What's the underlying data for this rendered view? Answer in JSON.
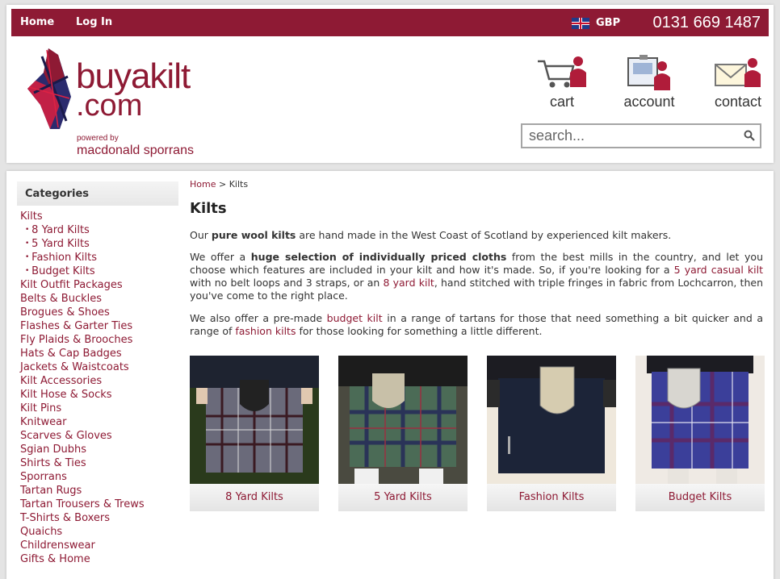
{
  "topbar": {
    "home": "Home",
    "login": "Log In",
    "currency": "GBP",
    "phone": "0131 669 1487"
  },
  "logo": {
    "word1": "buyakilt",
    "word2": ".com",
    "powered": "powered by",
    "brand": "macdonald sporrans"
  },
  "utility": {
    "cart": "cart",
    "account": "account",
    "contact": "contact"
  },
  "search": {
    "placeholder": "search..."
  },
  "sidebar": {
    "heading": "Categories",
    "items": [
      {
        "label": "Kilts",
        "sub": false
      },
      {
        "label": "8 Yard Kilts",
        "sub": true
      },
      {
        "label": "5 Yard Kilts",
        "sub": true
      },
      {
        "label": "Fashion Kilts",
        "sub": true
      },
      {
        "label": "Budget Kilts",
        "sub": true
      },
      {
        "label": "Kilt Outfit Packages",
        "sub": false
      },
      {
        "label": "Belts & Buckles",
        "sub": false
      },
      {
        "label": "Brogues & Shoes",
        "sub": false
      },
      {
        "label": "Flashes & Garter Ties",
        "sub": false
      },
      {
        "label": "Fly Plaids & Brooches",
        "sub": false
      },
      {
        "label": "Hats & Cap Badges",
        "sub": false
      },
      {
        "label": "Jackets & Waistcoats",
        "sub": false
      },
      {
        "label": "Kilt Accessories",
        "sub": false
      },
      {
        "label": "Kilt Hose & Socks",
        "sub": false
      },
      {
        "label": "Kilt Pins",
        "sub": false
      },
      {
        "label": "Knitwear",
        "sub": false
      },
      {
        "label": "Scarves & Gloves",
        "sub": false
      },
      {
        "label": "Sgian Dubhs",
        "sub": false
      },
      {
        "label": "Shirts & Ties",
        "sub": false
      },
      {
        "label": "Sporrans",
        "sub": false
      },
      {
        "label": "Tartan Rugs",
        "sub": false
      },
      {
        "label": "Tartan Trousers & Trews",
        "sub": false
      },
      {
        "label": "T-Shirts & Boxers",
        "sub": false
      },
      {
        "label": "Quaichs",
        "sub": false
      },
      {
        "label": "Childrenswear",
        "sub": false
      },
      {
        "label": "Gifts & Home",
        "sub": false
      }
    ]
  },
  "breadcrumb": {
    "home": "Home",
    "sep": ">",
    "current": "Kilts"
  },
  "page_title": "Kilts",
  "intro": {
    "p1_a": "Our ",
    "p1_b": "pure wool kilts",
    "p1_c": " are hand made in the West Coast of Scotland by experienced kilt makers.",
    "p2_a": "We offer a ",
    "p2_b": "huge selection of individually priced cloths",
    "p2_c": " from the best mills in the country, and let you choose which features are included in your kilt and how it's made. So, if you're looking for a ",
    "p2_link1": "5 yard casual kilt",
    "p2_d": " with no belt loops and 3 straps, or an ",
    "p2_link2": "8 yard kilt",
    "p2_e": ", hand stitched with triple fringes in fabric from Lochcarron, then you've come to the right place.",
    "p3_a": "We also offer a pre-made ",
    "p3_link1": "budget kilt",
    "p3_b": " in a range of tartans for those that need something a bit quicker and a range of ",
    "p3_link2": "fashion kilts",
    "p3_c": " for those looking for something a little different."
  },
  "cards": [
    {
      "label": "8 Yard Kilts"
    },
    {
      "label": "5 Yard Kilts"
    },
    {
      "label": "Fashion Kilts"
    },
    {
      "label": "Budget Kilts"
    }
  ],
  "colors": {
    "brand": "#8e1a34"
  }
}
